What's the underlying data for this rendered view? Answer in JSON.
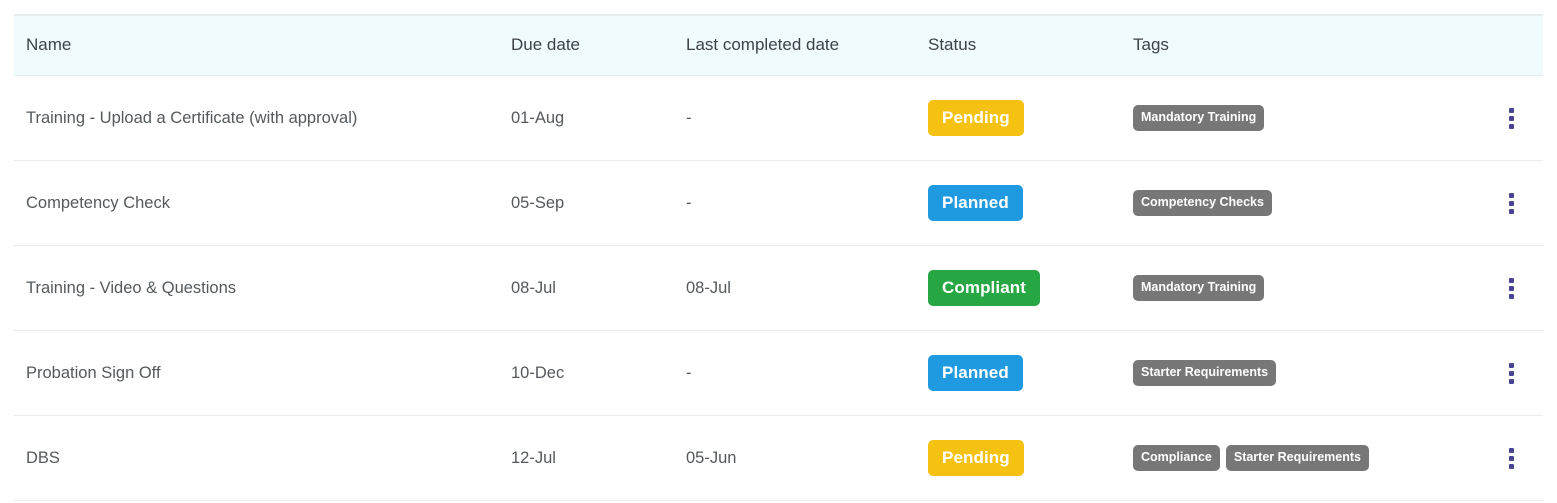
{
  "table": {
    "columns": [
      {
        "key": "name",
        "label": "Name"
      },
      {
        "key": "due",
        "label": "Due date"
      },
      {
        "key": "last",
        "label": "Last completed date"
      },
      {
        "key": "status",
        "label": "Status"
      },
      {
        "key": "tags",
        "label": "Tags"
      }
    ],
    "rows": [
      {
        "name": "Training - Upload a Certificate (with approval)",
        "due_date": "01-Aug",
        "last_completed_date": "-",
        "status": "Pending",
        "status_color": "#f5c211",
        "tags": [
          "Mandatory Training"
        ],
        "row_menu": "row-actions-menu"
      },
      {
        "name": "Competency Check",
        "due_date": "05-Sep",
        "last_completed_date": "-",
        "status": "Planned",
        "status_color": "#1f9ae0",
        "tags": [
          "Competency Checks"
        ],
        "row_menu": "row-actions-menu"
      },
      {
        "name": "Training - Video & Questions",
        "due_date": "08-Jul",
        "last_completed_date": "08-Jul",
        "status": "Compliant",
        "status_color": "#27a744",
        "tags": [
          "Mandatory Training"
        ],
        "row_menu": "row-actions-menu"
      },
      {
        "name": "Probation Sign Off",
        "due_date": "10-Dec",
        "last_completed_date": "-",
        "status": "Planned",
        "status_color": "#1f9ae0",
        "tags": [
          "Starter Requirements"
        ],
        "row_menu": "row-actions-menu"
      },
      {
        "name": "DBS",
        "due_date": "12-Jul",
        "last_completed_date": "05-Jun",
        "status": "Pending",
        "status_color": "#f5c211",
        "tags": [
          "Compliance",
          "Starter Requirements"
        ],
        "row_menu": "row-actions-menu"
      }
    ],
    "icons": {
      "row_menu_icon": "kebab-menu-icon"
    },
    "colors": {
      "header_background": "#effbfd",
      "tag_background": "#777777",
      "menu_icon": "#4a4494",
      "row_divider": "#ececec",
      "text": "#55595c"
    }
  }
}
